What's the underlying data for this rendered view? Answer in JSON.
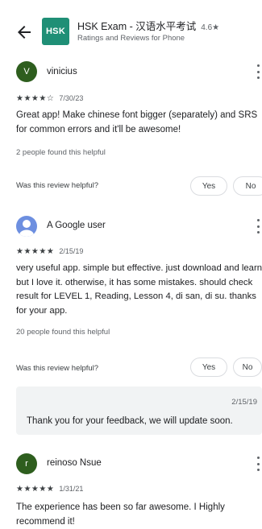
{
  "app": {
    "icon_text": "HSK",
    "title": "HSK Exam - 汉语水平考试",
    "rating": "4.6★",
    "subtitle": "Ratings and Reviews for Phone"
  },
  "labels": {
    "was_helpful": "Was this review helpful?",
    "yes": "Yes",
    "no": "No"
  },
  "reviews": [
    {
      "initial": "V",
      "avatar_color": "#2e5e1e",
      "name": "vinicius",
      "stars": "★★★★☆",
      "date": "7/30/23",
      "text": "Great app! Make chinese font bigger (separately) and SRS for common errors and it'll be awesome!",
      "helpful": "2 people found this helpful"
    },
    {
      "initial": "",
      "avatar_color": "#6d8fe0",
      "name": "A Google user",
      "stars": "★★★★★",
      "date": "2/15/19",
      "text": "very useful app. simple but effective. just download and learn but I love it. otherwise, it has some mistakes. should check result for LEVEL 1, Reading, Lesson 4, di san, di su. thanks for your app.",
      "helpful": "20 people found this helpful",
      "reply": {
        "date": "2/15/19",
        "text": "Thank you for your feedback, we will update soon."
      }
    },
    {
      "initial": "r",
      "avatar_color": "#2e5e1e",
      "name": "reinoso Nsue",
      "stars": "★★★★★",
      "date": "1/31/21",
      "text": "The experience has been so far awesome. I Highly recommend it!"
    }
  ]
}
